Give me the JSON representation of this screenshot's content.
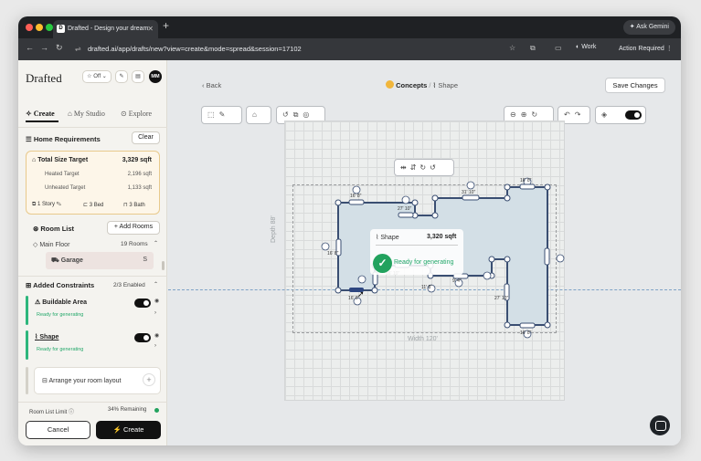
{
  "browser": {
    "tab_title": "Drafted - Design your dream",
    "tab_favicon": "D",
    "new_tab": "+",
    "gemini": "✦ Ask Gemini",
    "url": "drafted.ai/app/drafts/new?view=create&mode=spread&session=17102",
    "profile": "Work",
    "action_required": "Action Required ⋮"
  },
  "sidebar": {
    "logo": "Drafted",
    "off_pill": "☆ Off ⌄",
    "avatar": "MM",
    "nav": {
      "create": "Create",
      "my_studio": "My Studio",
      "explore": "Explore"
    },
    "home_requirements": "Home Requirements",
    "clear": "Clear",
    "total_size_label": "Total Size Target",
    "total_size_value": "3,329 sqft",
    "heated_label": "Heated Target",
    "heated_value": "2,196 sqft",
    "unheated_label": "Unheated Target",
    "unheated_value": "1,133 sqft",
    "story": "1 Story",
    "bed": "3 Bed",
    "bath": "3 Bath",
    "room_list": "Room List",
    "add_rooms": "+ Add Rooms",
    "main_floor": "Main Floor",
    "main_floor_count": "19 Rooms",
    "garage": "Garage",
    "garage_size": "S",
    "added_constraints": "Added Constraints",
    "constraints_enabled": "2/3 Enabled",
    "buildable_area": "Buildable Area",
    "buildable_status": "Ready for generating",
    "shape": "Shape",
    "shape_status": "Ready for generating",
    "arrange": "Arrange your room layout",
    "room_limit": "Room List Limit ⓘ",
    "remaining": "34% Remaining",
    "cancel": "Cancel",
    "create": "Create"
  },
  "main": {
    "back": "‹ Back",
    "breadcrumb_concepts": "Concepts",
    "breadcrumb_sep": "/",
    "breadcrumb_shape": "Shape",
    "save_changes": "Save Changes",
    "depth_label": "Depth 88'",
    "width_label": "Width 120'",
    "shape_label": "Shape",
    "shape_value": "3,320 sqft",
    "ready": "Ready for generating",
    "dims": [
      "16' 8\"",
      "27' 10\"",
      "31' 10\"",
      "16' 8\"",
      "16' 8\"",
      "27' 10\"",
      "16' 8\"",
      "9' 4\"",
      "16' 10\"",
      "11' 8\"",
      "16' 8\""
    ]
  },
  "colors": {
    "accent_green": "#22a25e",
    "shape_fill": "#d3dfe6",
    "shape_stroke": "#3a4e72",
    "req_card_border": "#e8c98c"
  }
}
